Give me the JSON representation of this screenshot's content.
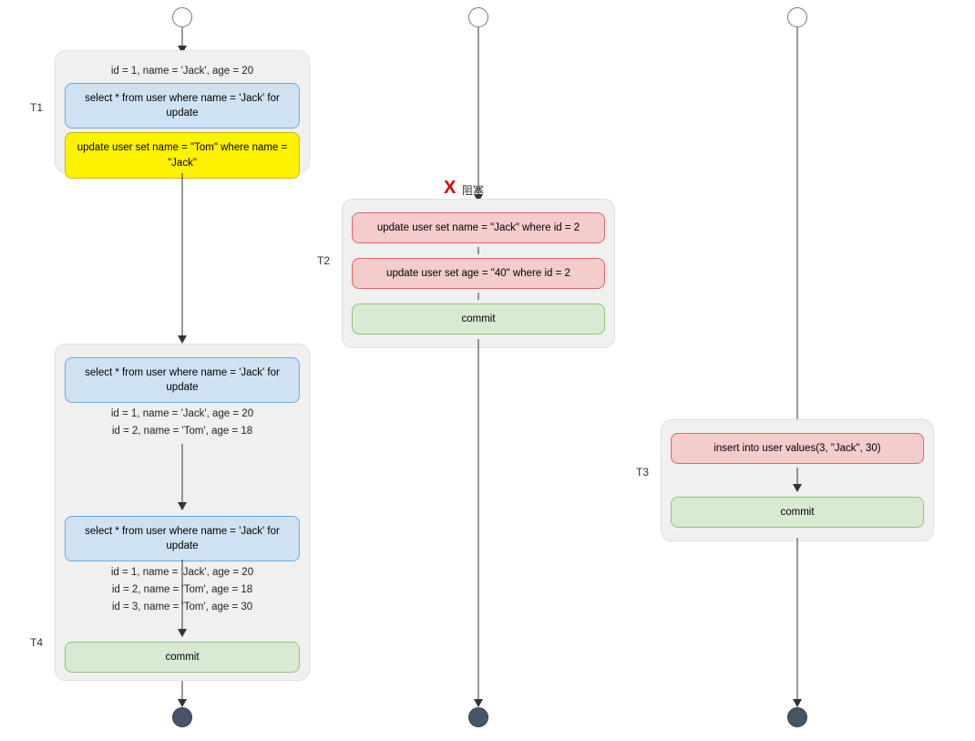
{
  "labels": {
    "t1": "T1",
    "t2": "T2",
    "t3": "T3",
    "t4": "T4",
    "block": "阻塞",
    "commit": "commit"
  },
  "t1": {
    "ann1": "id = 1, name = 'Jack', age = 20",
    "sql1": "select * from user where name = 'Jack' for update",
    "sql2": "update user set name = \"Tom\" where name = \"Jack\""
  },
  "t4": {
    "sql1": "select * from user where name = 'Jack' for update",
    "ann_block1_l1": "id = 1, name = 'Jack', age = 20",
    "ann_block1_l2": "id = 2, name = 'Tom', age = 18",
    "sql2": "select * from user where name = 'Jack' for update",
    "ann_block2_l1": "id = 1, name = 'Jack', age = 20",
    "ann_block2_l2": "id = 2, name = 'Tom', age = 18",
    "ann_block2_l3": "id = 3, name = 'Tom', age = 30"
  },
  "t2": {
    "sql1": "update user set name = \"Jack\" where id = 2",
    "sql2": "update user set age = \"40\" where id = 2"
  },
  "t3": {
    "sql1": "insert into user values(3, \"Jack\", 30)"
  }
}
